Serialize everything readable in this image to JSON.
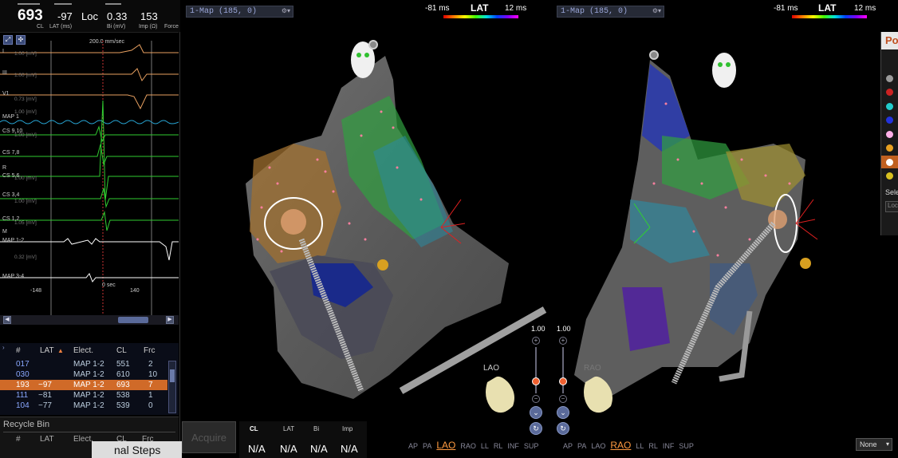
{
  "stats": {
    "cl_value": "693",
    "cl_label": "CL",
    "lat_value": "-97",
    "lat_label": "LAT (ms)",
    "loc_value": "Loc",
    "bi_value": "0.33",
    "bi_label": "Bi (mV)",
    "imp_value": "153",
    "imp_label": "Imp (Ω)",
    "force_label": "Force"
  },
  "ecg": {
    "speed": "200.0 mm/sec",
    "time_zero": "0 sec",
    "time_left": "-148",
    "time_right": "140",
    "channels": [
      {
        "name": "I",
        "scale": "1.00 [mV]"
      },
      {
        "name": "III",
        "scale": "1.00 [mV]"
      },
      {
        "name": "V1",
        "scale": "0.73 [mV]"
      },
      {
        "name": "MAP 1",
        "scale": "1.00 [mV]"
      },
      {
        "name": "CS 9,10",
        "scale": "1.00 [mV]"
      },
      {
        "name": "CS 7,8",
        "scale": "1.00 [mV]"
      },
      {
        "name": "R",
        "scale": ""
      },
      {
        "name": "CS 5,6",
        "scale": "1.00 [mV]"
      },
      {
        "name": "CS 3,4",
        "scale": "1.00 [mV]"
      },
      {
        "name": "CS 1,2",
        "scale": "1.05 [mV]"
      },
      {
        "name": "M",
        "scale": ""
      },
      {
        "name": "MAP 1-2",
        "scale": "0.32 [mV]"
      },
      {
        "name": "MAP 3-4",
        "scale": ""
      }
    ]
  },
  "table": {
    "columns": [
      "#",
      "LAT",
      "Elect.",
      "CL",
      "Frc"
    ],
    "rows": [
      {
        "id": "017",
        "lat": "",
        "elect": "MAP 1-2",
        "cl": "551",
        "frc": "2",
        "selected": false
      },
      {
        "id": "030",
        "lat": "",
        "elect": "MAP 1-2",
        "cl": "610",
        "frc": "10",
        "selected": false
      },
      {
        "id": "193",
        "lat": "−97",
        "elect": "MAP 1-2",
        "cl": "693",
        "frc": "7",
        "selected": true
      },
      {
        "id": "111",
        "lat": "−81",
        "elect": "MAP 1-2",
        "cl": "538",
        "frc": "1",
        "selected": false
      },
      {
        "id": "104",
        "lat": "−77",
        "elect": "MAP 1-2",
        "cl": "539",
        "frc": "0",
        "selected": false
      }
    ]
  },
  "recycle_bin": {
    "title": "Recycle Bin",
    "columns": [
      "#",
      "LAT",
      "Elect.",
      "CL",
      "Frc"
    ]
  },
  "final_steps": {
    "label": "nal Steps"
  },
  "maps": [
    {
      "selector": "1-Map (185, 0)",
      "lat_min": "-81 ms",
      "lat_title": "LAT",
      "lat_max": "12 ms",
      "zoom_label": "1.00",
      "orientation_label": "LAO",
      "views": [
        "AP",
        "PA",
        "LAO",
        "RAO",
        "LL",
        "RL",
        "INF",
        "SUP"
      ],
      "active_view": "LAO"
    },
    {
      "selector": "1-Map (185, 0)",
      "lat_min": "-81 ms",
      "lat_title": "LAT",
      "lat_max": "12 ms",
      "zoom_label": "1.00",
      "orientation_label": "RAO",
      "views": [
        "AP",
        "PA",
        "LAO",
        "RAO",
        "LL",
        "RL",
        "INF",
        "SUP"
      ],
      "active_view": "RAO"
    }
  ],
  "acquire": {
    "label": "Acquire"
  },
  "readout": {
    "labels": [
      "CL",
      "LAT",
      "Bi",
      "Imp"
    ],
    "values": [
      "N/A",
      "N/A",
      "N/A",
      "N/A"
    ]
  },
  "palette": {
    "title": "Po",
    "select_label": "Sele",
    "loc_placeholder": "Loc",
    "colors": [
      "#9a9a9a",
      "#cc2222",
      "#22cccc",
      "#2233dd",
      "#ffb0e8",
      "#e8a020",
      "#ffffff",
      "#d8c020"
    ]
  },
  "none_select": {
    "value": "None"
  }
}
